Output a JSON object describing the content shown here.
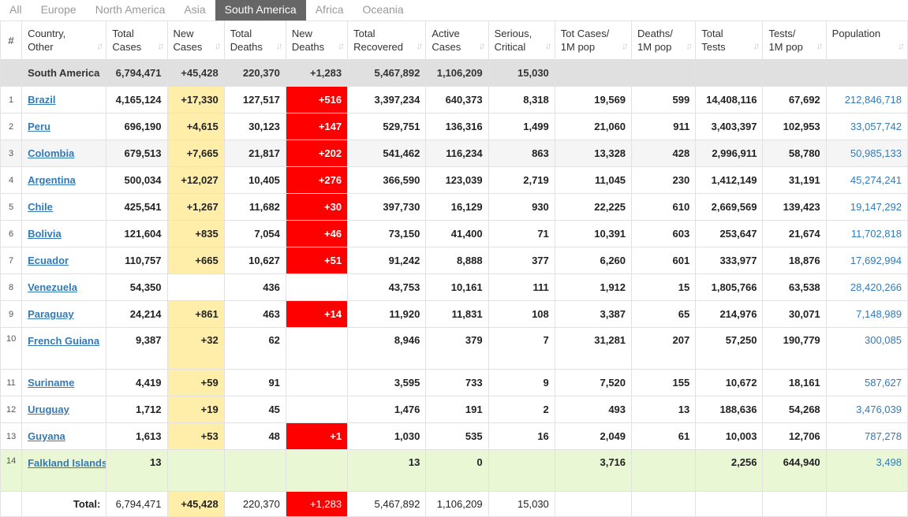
{
  "tabs": [
    "All",
    "Europe",
    "North America",
    "Asia",
    "South America",
    "Africa",
    "Oceania"
  ],
  "active_tab": "South America",
  "headers": [
    {
      "l1": "#",
      "l2": ""
    },
    {
      "l1": "Country,",
      "l2": "Other"
    },
    {
      "l1": "Total",
      "l2": "Cases"
    },
    {
      "l1": "New",
      "l2": "Cases"
    },
    {
      "l1": "Total",
      "l2": "Deaths"
    },
    {
      "l1": "New",
      "l2": "Deaths"
    },
    {
      "l1": "Total",
      "l2": "Recovered"
    },
    {
      "l1": "Active",
      "l2": "Cases"
    },
    {
      "l1": "Serious,",
      "l2": "Critical"
    },
    {
      "l1": "Tot Cases/",
      "l2": "1M pop"
    },
    {
      "l1": "Deaths/",
      "l2": "1M pop"
    },
    {
      "l1": "Total",
      "l2": "Tests"
    },
    {
      "l1": "Tests/",
      "l2": "1M pop"
    },
    {
      "l1": "Population",
      "l2": ""
    }
  ],
  "sort_glyph": "↓↑",
  "region_row": [
    "",
    "South America",
    "6,794,471",
    "+45,428",
    "220,370",
    "+1,283",
    "5,467,892",
    "1,106,209",
    "15,030",
    "",
    "",
    "",
    "",
    ""
  ],
  "rows": [
    [
      "1",
      "Brazil",
      "4,165,124",
      "+17,330",
      "127,517",
      "+516",
      "3,397,234",
      "640,373",
      "8,318",
      "19,569",
      "599",
      "14,408,116",
      "67,692",
      "212,846,718"
    ],
    [
      "2",
      "Peru",
      "696,190",
      "+4,615",
      "30,123",
      "+147",
      "529,751",
      "136,316",
      "1,499",
      "21,060",
      "911",
      "3,403,397",
      "102,953",
      "33,057,742"
    ],
    [
      "3",
      "Colombia",
      "679,513",
      "+7,665",
      "21,817",
      "+202",
      "541,462",
      "116,234",
      "863",
      "13,328",
      "428",
      "2,996,911",
      "58,780",
      "50,985,133"
    ],
    [
      "4",
      "Argentina",
      "500,034",
      "+12,027",
      "10,405",
      "+276",
      "366,590",
      "123,039",
      "2,719",
      "11,045",
      "230",
      "1,412,149",
      "31,191",
      "45,274,241"
    ],
    [
      "5",
      "Chile",
      "425,541",
      "+1,267",
      "11,682",
      "+30",
      "397,730",
      "16,129",
      "930",
      "22,225",
      "610",
      "2,669,569",
      "139,423",
      "19,147,292"
    ],
    [
      "6",
      "Bolivia",
      "121,604",
      "+835",
      "7,054",
      "+46",
      "73,150",
      "41,400",
      "71",
      "10,391",
      "603",
      "253,647",
      "21,674",
      "11,702,818"
    ],
    [
      "7",
      "Ecuador",
      "110,757",
      "+665",
      "10,627",
      "+51",
      "91,242",
      "8,888",
      "377",
      "6,260",
      "601",
      "333,977",
      "18,876",
      "17,692,994"
    ],
    [
      "8",
      "Venezuela",
      "54,350",
      "",
      "436",
      "",
      "43,753",
      "10,161",
      "111",
      "1,912",
      "15",
      "1,805,766",
      "63,538",
      "28,420,266"
    ],
    [
      "9",
      "Paraguay",
      "24,214",
      "+861",
      "463",
      "+14",
      "11,920",
      "11,831",
      "108",
      "3,387",
      "65",
      "214,976",
      "30,071",
      "7,148,989"
    ],
    [
      "10",
      "French Guiana",
      "9,387",
      "+32",
      "62",
      "",
      "8,946",
      "379",
      "7",
      "31,281",
      "207",
      "57,250",
      "190,779",
      "300,085"
    ],
    [
      "11",
      "Suriname",
      "4,419",
      "+59",
      "91",
      "",
      "3,595",
      "733",
      "9",
      "7,520",
      "155",
      "10,672",
      "18,161",
      "587,627"
    ],
    [
      "12",
      "Uruguay",
      "1,712",
      "+19",
      "45",
      "",
      "1,476",
      "191",
      "2",
      "493",
      "13",
      "188,636",
      "54,268",
      "3,476,039"
    ],
    [
      "13",
      "Guyana",
      "1,613",
      "+53",
      "48",
      "+1",
      "1,030",
      "535",
      "16",
      "2,049",
      "61",
      "10,003",
      "12,706",
      "787,278"
    ],
    [
      "14",
      "Falkland Islands",
      "13",
      "",
      "",
      "",
      "13",
      "0",
      "",
      "3,716",
      "",
      "2,256",
      "644,940",
      "3,498"
    ]
  ],
  "total_row": [
    "",
    "Total:",
    "6,794,471",
    "+45,428",
    "220,370",
    "+1,283",
    "5,467,892",
    "1,106,209",
    "15,030",
    "",
    "",
    "",
    "",
    ""
  ],
  "colors": {
    "new_cases_bg": "#ffeeaa",
    "new_deaths_bg": "#ff0000",
    "link": "#337ab7",
    "region_bg": "#e0e0e0",
    "highlight_row_bg": "#eaf7d5"
  }
}
